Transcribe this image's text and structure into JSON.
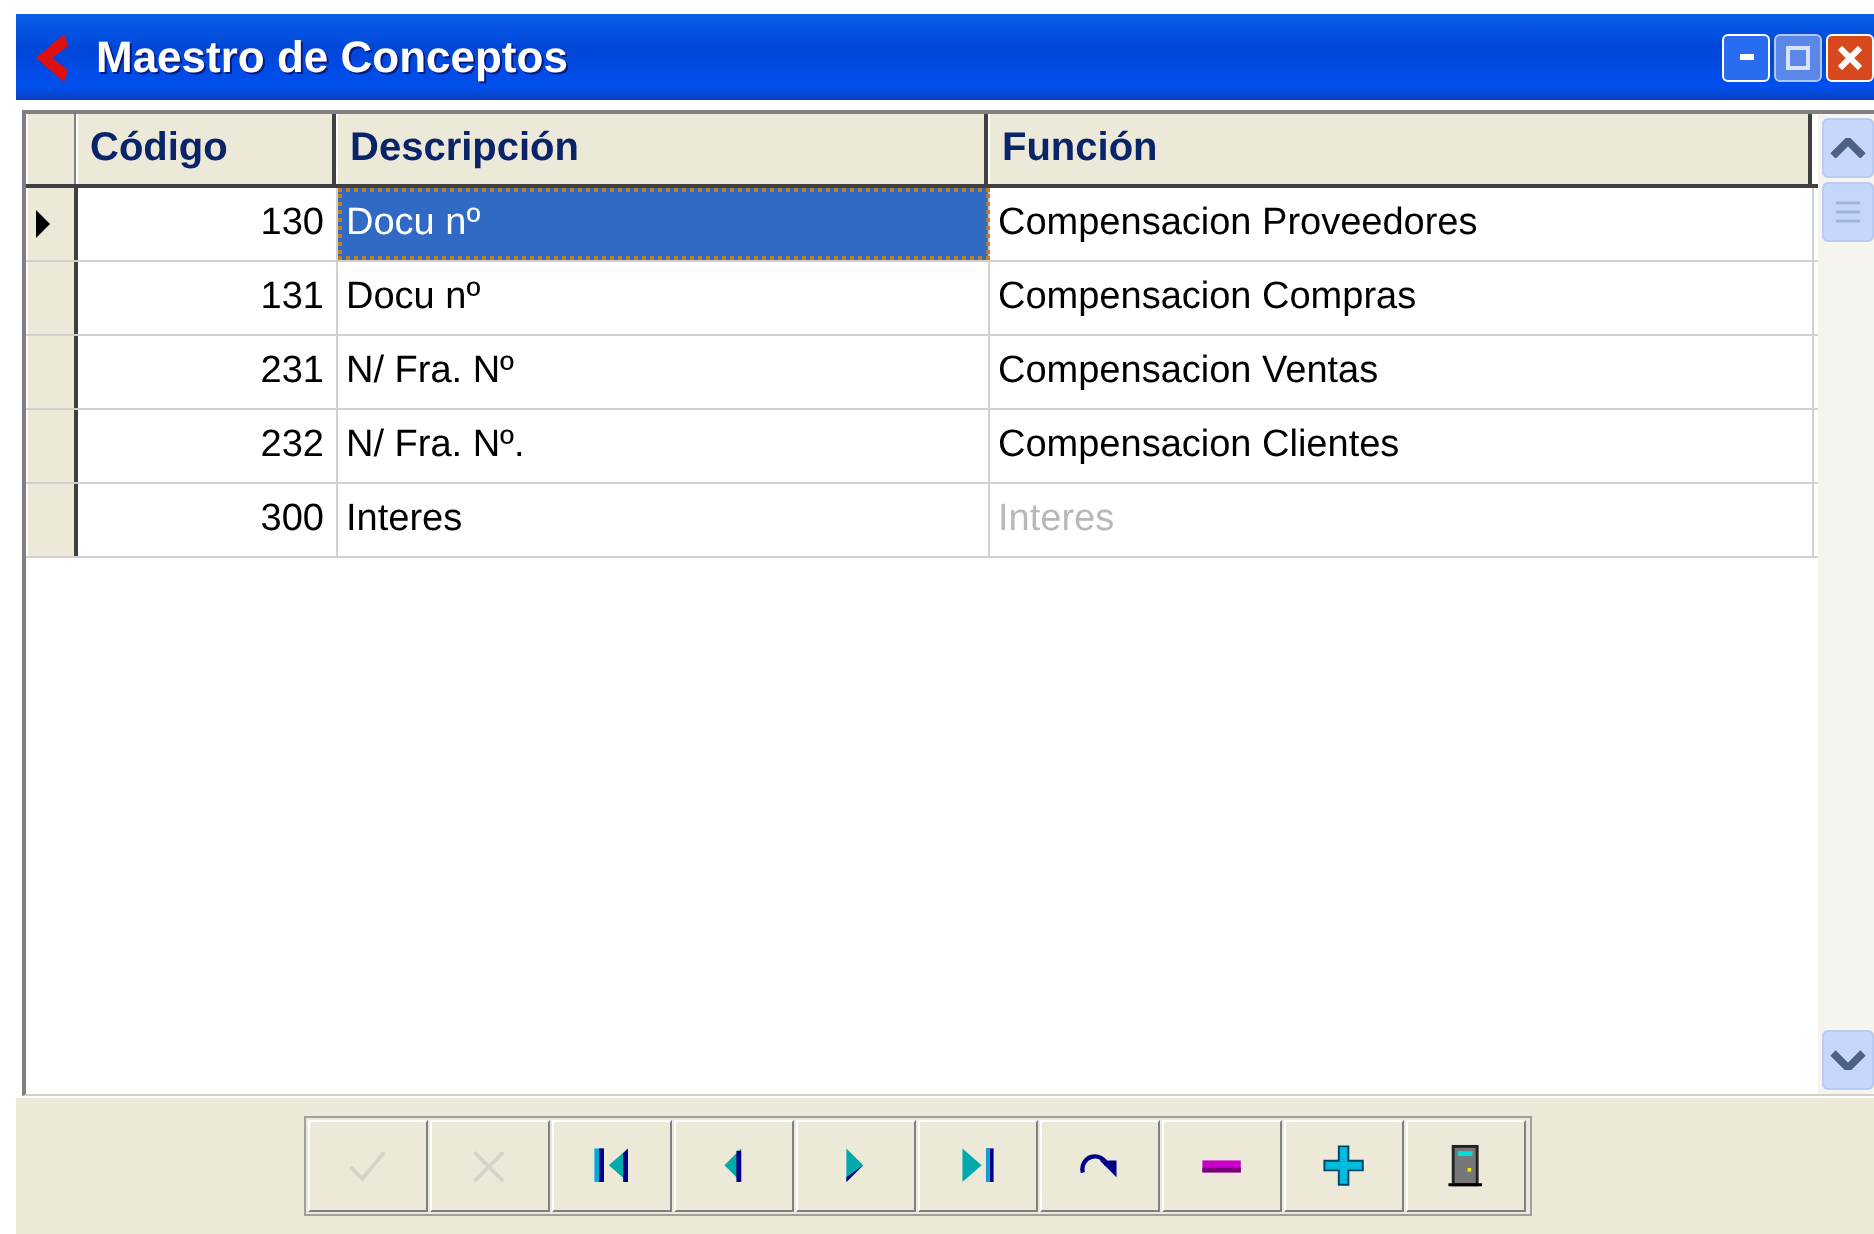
{
  "window": {
    "title": "Maestro de Conceptos"
  },
  "table": {
    "columns": [
      "Código",
      "Descripción",
      "Función"
    ],
    "rows": [
      {
        "codigo": "130",
        "descripcion": "Docu nº",
        "funcion": "Compensacion Proveedores",
        "selected": true,
        "funcion_dimmed": false
      },
      {
        "codigo": "131",
        "descripcion": "Docu nº",
        "funcion": "Compensacion Compras",
        "selected": false,
        "funcion_dimmed": false
      },
      {
        "codigo": "231",
        "descripcion": "N/ Fra. Nº",
        "funcion": "Compensacion Ventas",
        "selected": false,
        "funcion_dimmed": false
      },
      {
        "codigo": "232",
        "descripcion": "N/ Fra. Nº.",
        "funcion": "Compensacion Clientes",
        "selected": false,
        "funcion_dimmed": false
      },
      {
        "codigo": "300",
        "descripcion": "Interes",
        "funcion": "Interes",
        "selected": false,
        "funcion_dimmed": true
      }
    ]
  },
  "navigator": [
    {
      "kind": "post",
      "disabled": true
    },
    {
      "kind": "cancel",
      "disabled": true
    },
    {
      "kind": "first",
      "disabled": false
    },
    {
      "kind": "prior",
      "disabled": false
    },
    {
      "kind": "next",
      "disabled": false
    },
    {
      "kind": "last",
      "disabled": false
    },
    {
      "kind": "refresh",
      "disabled": false
    },
    {
      "kind": "delete",
      "disabled": false
    },
    {
      "kind": "insert",
      "disabled": false
    },
    {
      "kind": "exit",
      "disabled": false
    }
  ]
}
